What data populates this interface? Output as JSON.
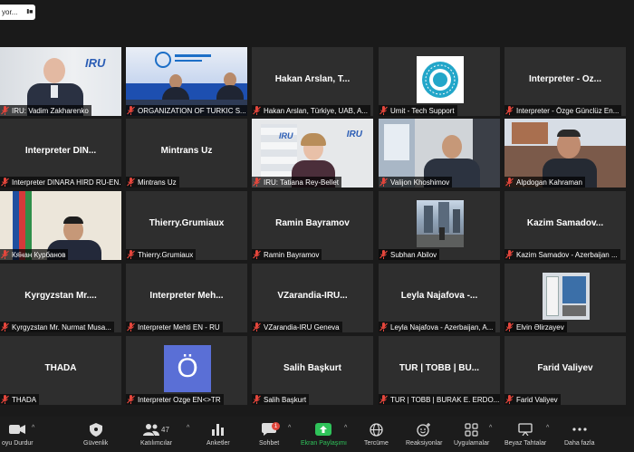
{
  "topbar": {
    "speaker_label": "yor...",
    "pause_glyph": "II ■"
  },
  "tiles": [
    {
      "label": "IRU: Vadim Zakharenko",
      "name": "",
      "type": "video"
    },
    {
      "label": "ORGANIZATION OF TURKIC S...",
      "name": "",
      "type": "video"
    },
    {
      "label": "Hakan Arslan, Türkiye, UAB, A...",
      "name": "Hakan Arslan, T...",
      "type": "name"
    },
    {
      "label": "Umit - Tech Support",
      "name": "",
      "type": "logo"
    },
    {
      "label": "Interpreter - Özge Günclüz En...",
      "name": "Interpreter - Öz...",
      "type": "name"
    },
    {
      "label": "Interpreter DINARA HIRD RU-EN...",
      "name": "Interpreter DIN...",
      "type": "name"
    },
    {
      "label": "Mintrans Uz",
      "name": "Mintrans Uz",
      "type": "name"
    },
    {
      "label": "IRU: Tatiana Rey-Bellet",
      "name": "",
      "type": "video"
    },
    {
      "label": "Valijon Khoshimov",
      "name": "",
      "type": "video"
    },
    {
      "label": "Alpdogan Kahraman",
      "name": "",
      "type": "video"
    },
    {
      "label": "Кя̈нан Курбанов",
      "name": "",
      "type": "video"
    },
    {
      "label": "Thierry.Grumiaux",
      "name": "Thierry.Grumiaux",
      "type": "name"
    },
    {
      "label": "Ramin Bayramov",
      "name": "Ramin Bayramov",
      "type": "name"
    },
    {
      "label": "Subhan Abilov",
      "name": "",
      "type": "photo"
    },
    {
      "label": "Kazim Samadov - Azerbaijan ...",
      "name": "Kazim Samadov...",
      "type": "name"
    },
    {
      "label": "Kyrgyzstan Mr. Nurmat Musa...",
      "name": "Kyrgyzstan Mr....",
      "type": "name"
    },
    {
      "label": "Interpreter Mehti EN - RU",
      "name": "Interpreter Meh...",
      "type": "name"
    },
    {
      "label": "VZarandia-IRU Geneva",
      "name": "VZarandia-IRU...",
      "type": "name"
    },
    {
      "label": "Leyla Najafova - Azerbaijan, A...",
      "name": "Leyla Najafova -...",
      "type": "name"
    },
    {
      "label": "Elvin Əlirzayev",
      "name": "",
      "type": "photo"
    },
    {
      "label": "THADA",
      "name": "THADA",
      "type": "name"
    },
    {
      "label": "Interpreter Ozge EN<>TR",
      "name": "",
      "type": "avatar",
      "avatar_letter": "Ö"
    },
    {
      "label": "Salih Başkurt",
      "name": "Salih Başkurt",
      "type": "name"
    },
    {
      "label": "TUR | TOBB | BURAK E. ERDO...",
      "name": "TUR | TOBB | BU...",
      "type": "name"
    },
    {
      "label": "Farid Valiyev",
      "name": "Farid Valiyev",
      "type": "name"
    }
  ],
  "toolbar": {
    "video": "oyu Durdur",
    "security": "Güvenlik",
    "participants": "Katılımcılar",
    "participants_count": "47",
    "polls": "Anketler",
    "chat": "Sohbet",
    "chat_badge": "1",
    "share": "Ekran Paylaşımı",
    "translation": "Tercüme",
    "reactions": "Reaksiyonlar",
    "apps": "Uygulamalar",
    "whiteboard": "Beyaz Tahtalar",
    "more": "Daha fazla"
  },
  "colors": {
    "share_green": "#2fc35a",
    "active_border": "#d9e36b",
    "badge_red": "#e0463c",
    "mic_red": "#e5463c"
  }
}
